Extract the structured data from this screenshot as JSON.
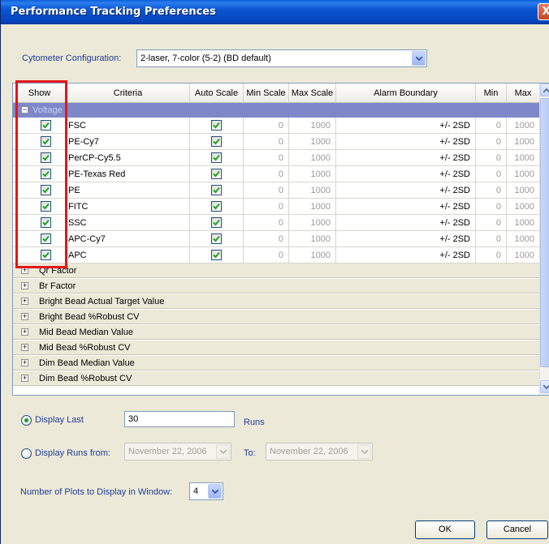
{
  "window": {
    "title": "Performance Tracking Preferences",
    "close_label": "X"
  },
  "config": {
    "label": "Cytometer Configuration:",
    "value": "2-laser, 7-color (5-2) (BD default)"
  },
  "columns": [
    "Show",
    "Criteria",
    "Auto Scale",
    "Min Scale",
    "Max Scale",
    "Alarm Boundary",
    "Min",
    "Max"
  ],
  "expanded_group": {
    "toggle": "−",
    "label": "Voltage"
  },
  "rows": [
    {
      "show": true,
      "criteria": "FSC",
      "auto": true,
      "min_scale": "0",
      "max_scale": "1000",
      "alarm": "+/- 2SD",
      "min": "0",
      "max": "1000"
    },
    {
      "show": true,
      "criteria": "PE-Cy7",
      "auto": true,
      "min_scale": "0",
      "max_scale": "1000",
      "alarm": "+/- 2SD",
      "min": "0",
      "max": "1000"
    },
    {
      "show": true,
      "criteria": "PerCP-Cy5.5",
      "auto": true,
      "min_scale": "0",
      "max_scale": "1000",
      "alarm": "+/- 2SD",
      "min": "0",
      "max": "1000"
    },
    {
      "show": true,
      "criteria": "PE-Texas Red",
      "auto": true,
      "min_scale": "0",
      "max_scale": "1000",
      "alarm": "+/- 2SD",
      "min": "0",
      "max": "1000"
    },
    {
      "show": true,
      "criteria": "PE",
      "auto": true,
      "min_scale": "0",
      "max_scale": "1000",
      "alarm": "+/- 2SD",
      "min": "0",
      "max": "1000"
    },
    {
      "show": true,
      "criteria": "FITC",
      "auto": true,
      "min_scale": "0",
      "max_scale": "1000",
      "alarm": "+/- 2SD",
      "min": "0",
      "max": "1000"
    },
    {
      "show": true,
      "criteria": "SSC",
      "auto": true,
      "min_scale": "0",
      "max_scale": "1000",
      "alarm": "+/- 2SD",
      "min": "0",
      "max": "1000"
    },
    {
      "show": true,
      "criteria": "APC-Cy7",
      "auto": true,
      "min_scale": "0",
      "max_scale": "1000",
      "alarm": "+/- 2SD",
      "min": "0",
      "max": "1000"
    },
    {
      "show": true,
      "criteria": "APC",
      "auto": true,
      "min_scale": "0",
      "max_scale": "1000",
      "alarm": "+/- 2SD",
      "min": "0",
      "max": "1000"
    }
  ],
  "collapsed_groups": [
    {
      "toggle": "+",
      "label": "Qr Factor"
    },
    {
      "toggle": "+",
      "label": "Br Factor"
    },
    {
      "toggle": "+",
      "label": "Bright Bead Actual Target Value"
    },
    {
      "toggle": "+",
      "label": "Bright Bead %Robust CV"
    },
    {
      "toggle": "+",
      "label": "Mid Bead Median Value"
    },
    {
      "toggle": "+",
      "label": "Mid Bead %Robust CV"
    },
    {
      "toggle": "+",
      "label": "Dim Bead Median Value"
    },
    {
      "toggle": "+",
      "label": "Dim Bead %Robust CV"
    }
  ],
  "display_last": {
    "label": "Display Last",
    "value": "30",
    "unit": "Runs",
    "selected": true
  },
  "display_runs": {
    "label": "Display Runs from:",
    "from": "November 22, 2006",
    "to_label": "To:",
    "to": "November 22, 2006",
    "selected": false
  },
  "plots": {
    "label": "Number of Plots to Display in Window:",
    "value": "4"
  },
  "buttons": {
    "ok": "OK",
    "cancel": "Cancel"
  },
  "colors": {
    "title_bar": "#0a55d0",
    "group_header": "#7d88c8",
    "highlight_box": "#e3161b",
    "label_text": "#1f3d9a"
  }
}
